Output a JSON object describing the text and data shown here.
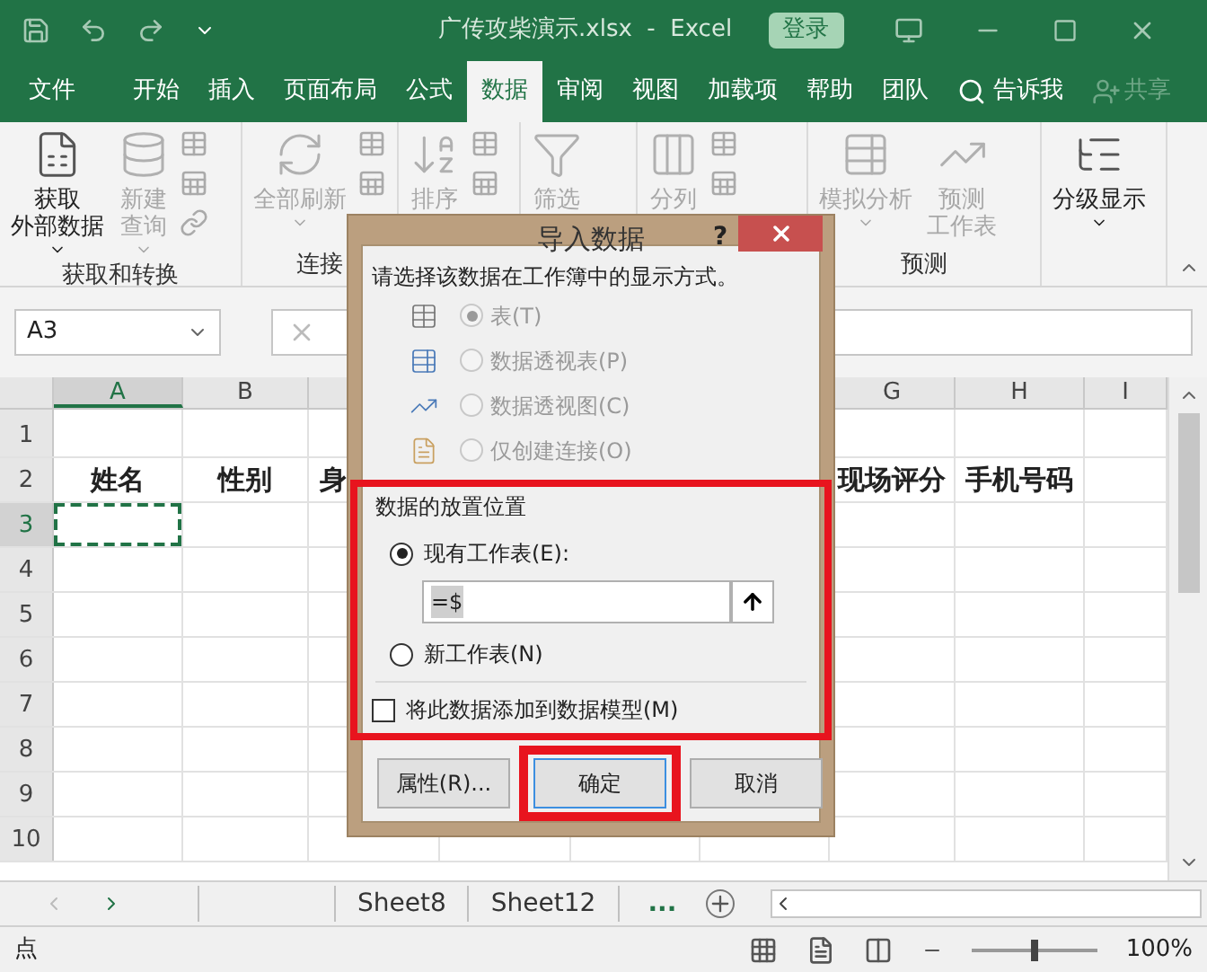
{
  "title_bar": {
    "title": "广传攻柴演示.xlsx  -  Excel",
    "sign_in": "登录"
  },
  "ribbon_tabs": [
    {
      "label": "文件",
      "selected": false
    },
    {
      "label": "开始",
      "selected": false
    },
    {
      "label": "插入",
      "selected": false
    },
    {
      "label": "页面布局",
      "selected": false
    },
    {
      "label": "公式",
      "selected": false
    },
    {
      "label": "数据",
      "selected": true
    },
    {
      "label": "审阅",
      "selected": false
    },
    {
      "label": "视图",
      "selected": false
    },
    {
      "label": "加载项",
      "selected": false
    },
    {
      "label": "帮助",
      "selected": false
    },
    {
      "label": "团队",
      "selected": false
    }
  ],
  "tell_me": "告诉我",
  "share": "共享",
  "ribbon_groups": [
    {
      "label": "获取和转换",
      "buttons": [
        {
          "lines": [
            "获取",
            "外部数据"
          ],
          "disabled": false,
          "dropdown": true
        },
        {
          "lines": [
            "新建",
            "查询"
          ],
          "disabled": true,
          "dropdown": true
        }
      ]
    },
    {
      "label": "连接",
      "buttons": [
        {
          "lines": [
            "全部刷新"
          ],
          "disabled": true,
          "dropdown": true
        }
      ]
    },
    {
      "buttons": [
        {
          "lines": [
            "排序"
          ],
          "disabled": true,
          "dropdown": false
        }
      ]
    },
    {
      "buttons": [
        {
          "lines": [
            "筛选"
          ],
          "disabled": true,
          "dropdown": false
        }
      ]
    },
    {
      "buttons": [
        {
          "lines": [
            "分列"
          ],
          "disabled": true,
          "dropdown": false
        }
      ]
    },
    {
      "label": "预测",
      "buttons": [
        {
          "lines": [
            "模拟分析"
          ],
          "disabled": true,
          "dropdown": true
        },
        {
          "lines": [
            "预测",
            "工作表"
          ],
          "disabled": true,
          "dropdown": false
        }
      ]
    },
    {
      "buttons": [
        {
          "lines": [
            "分级显示"
          ],
          "disabled": false,
          "dropdown": true
        }
      ]
    }
  ],
  "name_box": "A3",
  "columns": [
    {
      "label": "A",
      "selected": true
    },
    {
      "label": "B",
      "selected": false
    },
    {
      "label": "G",
      "selected": false
    },
    {
      "label": "H",
      "selected": false
    },
    {
      "label": "I",
      "selected": false
    }
  ],
  "rows": [
    {
      "label": "1",
      "selected": false
    },
    {
      "label": "2",
      "selected": false,
      "cells": [
        "姓名",
        "性别",
        "身",
        "现场评分",
        "手机号码"
      ]
    },
    {
      "label": "3",
      "selected": true
    },
    {
      "label": "4",
      "selected": false
    },
    {
      "label": "5",
      "selected": false
    },
    {
      "label": "6",
      "selected": false
    },
    {
      "label": "7",
      "selected": false
    },
    {
      "label": "8",
      "selected": false
    },
    {
      "label": "9",
      "selected": false
    },
    {
      "label": "10",
      "selected": false
    }
  ],
  "dialog": {
    "title": "导入数据",
    "help": "?",
    "prompt": "请选择该数据在工作簿中的显示方式。",
    "view_options": [
      {
        "label": "表(T)",
        "selected": true,
        "disabled": true
      },
      {
        "label": "数据透视表(P)",
        "selected": false,
        "disabled": true
      },
      {
        "label": "数据透视图(C)",
        "selected": false,
        "disabled": true
      },
      {
        "label": "仅创建连接(O)",
        "selected": false,
        "disabled": true
      }
    ],
    "placement": {
      "label": "数据的放置位置",
      "highlighted": true,
      "options": [
        {
          "label": "现有工作表(E):",
          "selected": true
        },
        {
          "label": "新工作表(N)",
          "selected": false
        }
      ],
      "location": "=$",
      "add_to_model": {
        "label": "将此数据添加到数据模型(M)",
        "checked": false
      }
    },
    "buttons": [
      {
        "label": "属性(R)...",
        "highlighted": false,
        "focused": false
      },
      {
        "label": "确定",
        "highlighted": true,
        "focused": true
      },
      {
        "label": "取消",
        "highlighted": false,
        "focused": false
      }
    ]
  },
  "sheet_tabs": [
    {
      "label": "Sheet8"
    },
    {
      "label": "Sheet12"
    }
  ],
  "more_sheets": "...",
  "status_text": "点",
  "zoom_slider": {
    "level": 0.5
  },
  "zoom_text": "100%"
}
